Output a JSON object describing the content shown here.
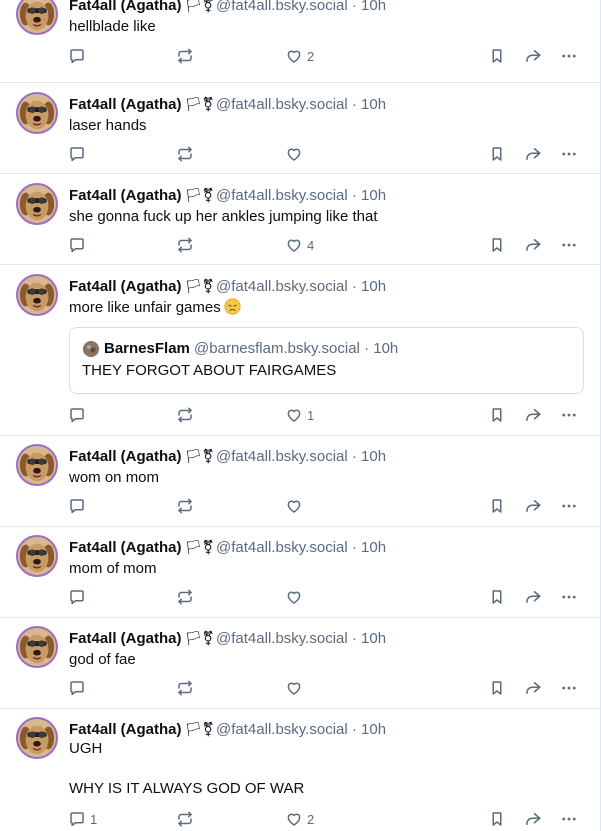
{
  "author": {
    "display_name": "Fat4all (Agatha)",
    "flags": "🏳⚧",
    "handle": "@fat4all.bsky.social",
    "separator": "·"
  },
  "icons": {
    "reply": "reply-bubble-icon",
    "repost": "repost-arrows-icon",
    "like": "heart-icon",
    "bookmark": "bookmark-icon",
    "share": "share-arrow-icon",
    "more": "more-ellipsis-icon"
  },
  "colors": {
    "muted": "#5b6b7e",
    "divider": "#e3e8ee",
    "avatar_ring": "#9a6cc8"
  },
  "posts": [
    {
      "time": "10h",
      "text": "hellblade like",
      "reply_count": "",
      "repost_count": "",
      "like_count": "2"
    },
    {
      "time": "10h",
      "text": "laser hands",
      "reply_count": "",
      "repost_count": "",
      "like_count": ""
    },
    {
      "time": "10h",
      "text": "she gonna fuck up her ankles jumping like that",
      "reply_count": "",
      "repost_count": "",
      "like_count": "4"
    },
    {
      "time": "10h",
      "text": "more like unfair games",
      "emoji": "pensive-face-emoji",
      "quote": {
        "display_name": "BarnesFlam",
        "handle": "@barnesflam.bsky.social",
        "time": "10h",
        "text": "THEY FORGOT ABOUT FAIRGAMES"
      },
      "reply_count": "",
      "repost_count": "",
      "like_count": "1"
    },
    {
      "time": "10h",
      "text": "wom on mom",
      "reply_count": "",
      "repost_count": "",
      "like_count": ""
    },
    {
      "time": "10h",
      "text": "mom of mom",
      "reply_count": "",
      "repost_count": "",
      "like_count": ""
    },
    {
      "time": "10h",
      "text": "god of fae",
      "reply_count": "",
      "repost_count": "",
      "like_count": ""
    },
    {
      "time": "10h",
      "text": "UGH\n\nWHY IS IT ALWAYS GOD OF WAR",
      "reply_count": "1",
      "repost_count": "",
      "like_count": "2"
    }
  ]
}
